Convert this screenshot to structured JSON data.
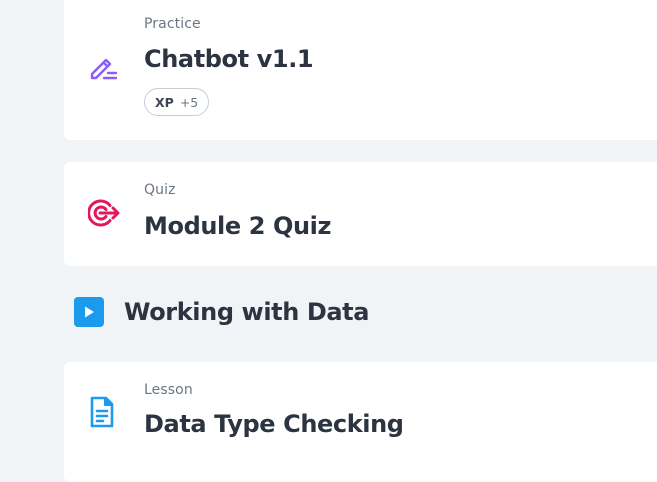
{
  "items": [
    {
      "type": "Practice",
      "title": "Chatbot v1.1",
      "xp": {
        "label": "XP",
        "value": "+5"
      },
      "icon": "pencil-icon",
      "icon_color": "#8b5cf6"
    },
    {
      "type": "Quiz",
      "title": "Module 2 Quiz",
      "icon": "target-icon",
      "icon_color": "#e3175e"
    }
  ],
  "section": {
    "title": "Working with Data",
    "icon": "play-icon",
    "icon_color": "#1c9bec"
  },
  "items_after": [
    {
      "type": "Lesson",
      "title": "Data Type Checking",
      "icon": "document-icon",
      "icon_color": "#1c9bec"
    }
  ]
}
